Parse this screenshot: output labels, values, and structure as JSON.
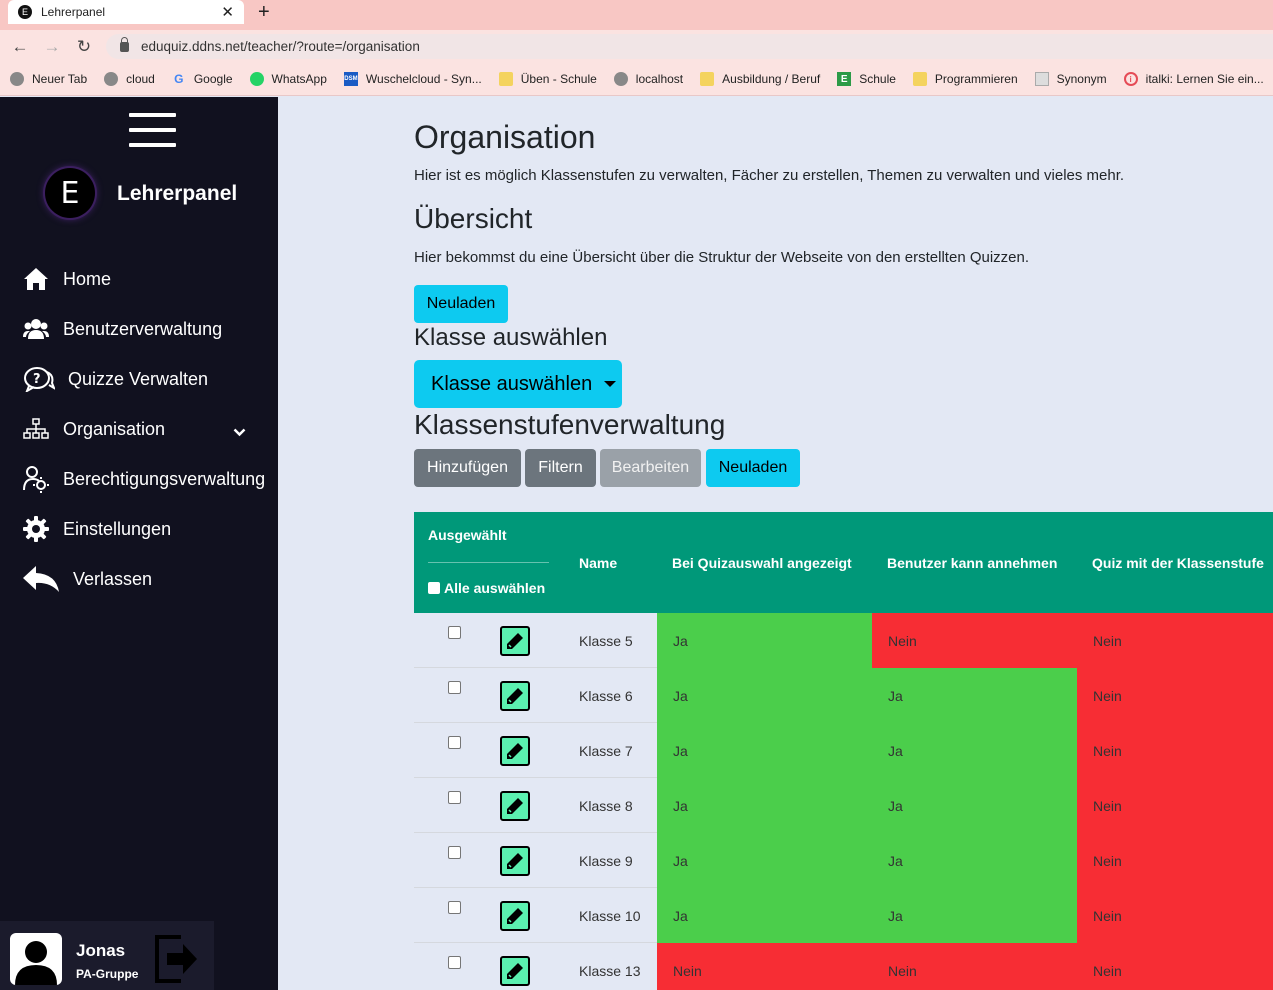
{
  "browser": {
    "tab_title": "Lehrerpanel",
    "tab_icon_letter": "E",
    "url": "eduquiz.ddns.net/teacher/?route=/organisation",
    "bookmarks": [
      {
        "label": "Neuer Tab",
        "icon": "globe-icon"
      },
      {
        "label": "cloud",
        "icon": "globe-icon"
      },
      {
        "label": "Google",
        "icon": "google-icon"
      },
      {
        "label": "WhatsApp",
        "icon": "whatsapp-icon"
      },
      {
        "label": "Wuschelcloud - Syn...",
        "icon": "dsm-icon"
      },
      {
        "label": "Üben - Schule",
        "icon": "folder-icon"
      },
      {
        "label": "localhost",
        "icon": "globe-icon"
      },
      {
        "label": "Ausbildung / Beruf",
        "icon": "folder-icon"
      },
      {
        "label": "Schule",
        "icon": "e-icon"
      },
      {
        "label": "Programmieren",
        "icon": "folder-icon"
      },
      {
        "label": "Synonym",
        "icon": "synonym-icon"
      },
      {
        "label": "italki: Lernen Sie ein...",
        "icon": "italki-icon"
      }
    ]
  },
  "sidebar": {
    "logo_letter": "E",
    "brand": "Lehrerpanel",
    "items": [
      {
        "label": "Home",
        "icon": "home-icon"
      },
      {
        "label": "Benutzerverwaltung",
        "icon": "users-icon"
      },
      {
        "label": "Quizze Verwalten",
        "icon": "quiz-icon"
      },
      {
        "label": "Organisation",
        "icon": "sitemap-icon"
      },
      {
        "label": "Berechtigungsverwaltung",
        "icon": "permission-icon"
      },
      {
        "label": "Einstellungen",
        "icon": "gear-icon"
      },
      {
        "label": "Verlassen",
        "icon": "back-arrow-icon"
      }
    ],
    "user": {
      "name": "Jonas",
      "group": "PA-Gruppe"
    }
  },
  "main": {
    "title": "Organisation",
    "intro": "Hier ist es möglich Klassenstufen zu verwalten, Fächer zu erstellen, Themen zu verwalten und vieles mehr.",
    "overview_title": "Übersicht",
    "overview_text": "Hier bekommst du eine Übersicht über die Struktur der Webseite von den erstellten Quizzen.",
    "reload_label": "Neuladen",
    "class_select_title": "Klasse auswählen",
    "class_select_button": "Klasse auswählen",
    "management_title": "Klassenstufenverwaltung",
    "toolbar": {
      "add": "Hinzufügen",
      "filter": "Filtern",
      "edit": "Bearbeiten",
      "reload": "Neuladen"
    },
    "colors": {
      "yes": "#4bce4b",
      "no": "#f72d34",
      "header": "#009879",
      "info": "#0dcaf0"
    },
    "table": {
      "selected_header": "Ausgewählt",
      "select_all": "Alle auswählen",
      "columns": [
        "Name",
        "Bei Quizauswahl angezeigt",
        "Benutzer kann annehmen",
        "Quiz mit der Klassenstufe"
      ],
      "rows": [
        {
          "name": "Klasse 5",
          "shown": "Ja",
          "accept": "Nein",
          "quiz": "Nein"
        },
        {
          "name": "Klasse 6",
          "shown": "Ja",
          "accept": "Ja",
          "quiz": "Nein"
        },
        {
          "name": "Klasse 7",
          "shown": "Ja",
          "accept": "Ja",
          "quiz": "Nein"
        },
        {
          "name": "Klasse 8",
          "shown": "Ja",
          "accept": "Ja",
          "quiz": "Nein"
        },
        {
          "name": "Klasse 9",
          "shown": "Ja",
          "accept": "Ja",
          "quiz": "Nein"
        },
        {
          "name": "Klasse 10",
          "shown": "Ja",
          "accept": "Ja",
          "quiz": "Nein"
        },
        {
          "name": "Klasse 13",
          "shown": "Nein",
          "accept": "Nein",
          "quiz": "Nein"
        }
      ]
    }
  }
}
